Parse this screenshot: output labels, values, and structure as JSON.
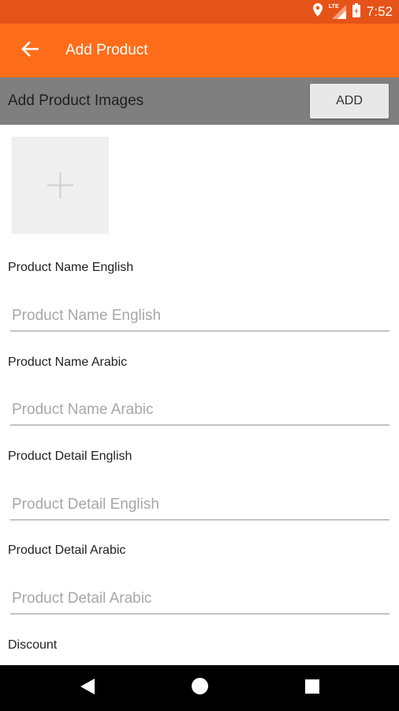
{
  "status_bar": {
    "time": "7:52",
    "network_label": "LTE",
    "icons": [
      "location-icon",
      "signal-icon",
      "battery-icon"
    ]
  },
  "app_bar": {
    "title": "Add Product",
    "back_icon": "arrow-back-icon",
    "background": "#ff6d1a"
  },
  "images_section": {
    "label": "Add Product Images",
    "add_button": "ADD",
    "add_image_icon": "plus-icon"
  },
  "form": {
    "fields": [
      {
        "label": "Product Name English",
        "placeholder": "Product Name English",
        "value": ""
      },
      {
        "label": "Product Name Arabic",
        "placeholder": "Product Name Arabic",
        "value": ""
      },
      {
        "label": "Product Detail English",
        "placeholder": "Product Detail English",
        "value": ""
      },
      {
        "label": "Product Detail Arabic",
        "placeholder": "Product Detail Arabic",
        "value": ""
      }
    ],
    "discount_label": "Discount"
  },
  "nav_bar": {
    "icons": [
      "back-triangle-icon",
      "home-circle-icon",
      "recents-square-icon"
    ]
  },
  "colors": {
    "status_bar": "#e65318",
    "app_bar": "#ff6d1a",
    "section_bar": "#7f7f7f"
  }
}
